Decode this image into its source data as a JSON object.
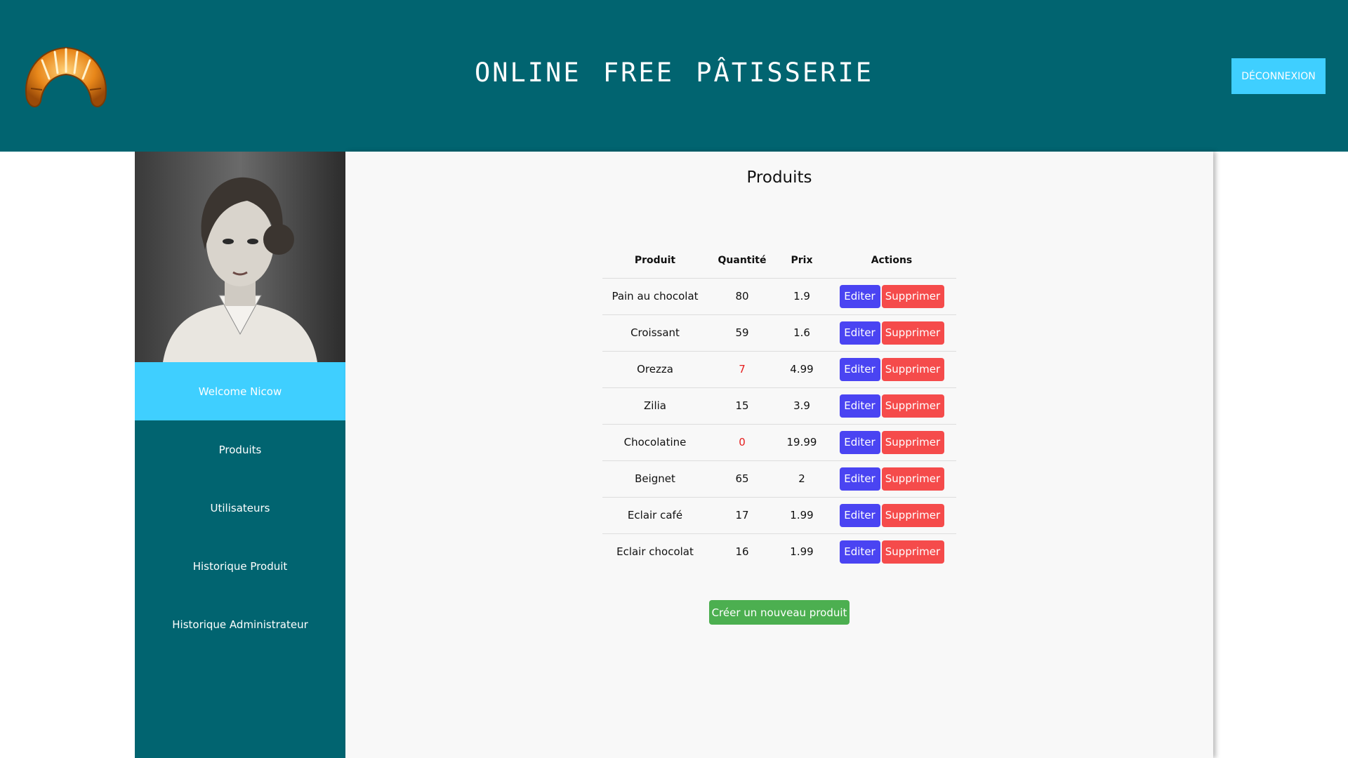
{
  "header": {
    "title": "ONLINE FREE PÂTISSERIE",
    "logout_label": "DÉCONNEXION",
    "logo_icon": "croissant-icon",
    "accent_color": "#3fcfff",
    "brand_color": "#016470"
  },
  "sidebar": {
    "avatar_icon": "portrait-image",
    "welcome": "Welcome Nicow",
    "items": [
      {
        "label": "Produits"
      },
      {
        "label": "Utilisateurs"
      },
      {
        "label": "Historique Produit"
      },
      {
        "label": "Historique Administrateur"
      }
    ]
  },
  "main": {
    "title": "Produits",
    "columns": [
      "Produit",
      "Quantité",
      "Prix",
      "Actions"
    ],
    "rows": [
      {
        "produit": "Pain au chocolat",
        "quantite": "80",
        "prix": "1.9",
        "low_stock": false
      },
      {
        "produit": "Croissant",
        "quantite": "59",
        "prix": "1.6",
        "low_stock": false
      },
      {
        "produit": "Orezza",
        "quantite": "7",
        "prix": "4.99",
        "low_stock": true
      },
      {
        "produit": "Zilia",
        "quantite": "15",
        "prix": "3.9",
        "low_stock": false
      },
      {
        "produit": "Chocolatine",
        "quantite": "0",
        "prix": "19.99",
        "low_stock": true
      },
      {
        "produit": "Beignet",
        "quantite": "65",
        "prix": "2",
        "low_stock": false
      },
      {
        "produit": "Eclair café",
        "quantite": "17",
        "prix": "1.99",
        "low_stock": false
      },
      {
        "produit": "Eclair chocolat",
        "quantite": "16",
        "prix": "1.99",
        "low_stock": false
      }
    ],
    "edit_label": "Editer",
    "delete_label": "Supprimer",
    "create_label": "Créer un nouveau produit"
  }
}
